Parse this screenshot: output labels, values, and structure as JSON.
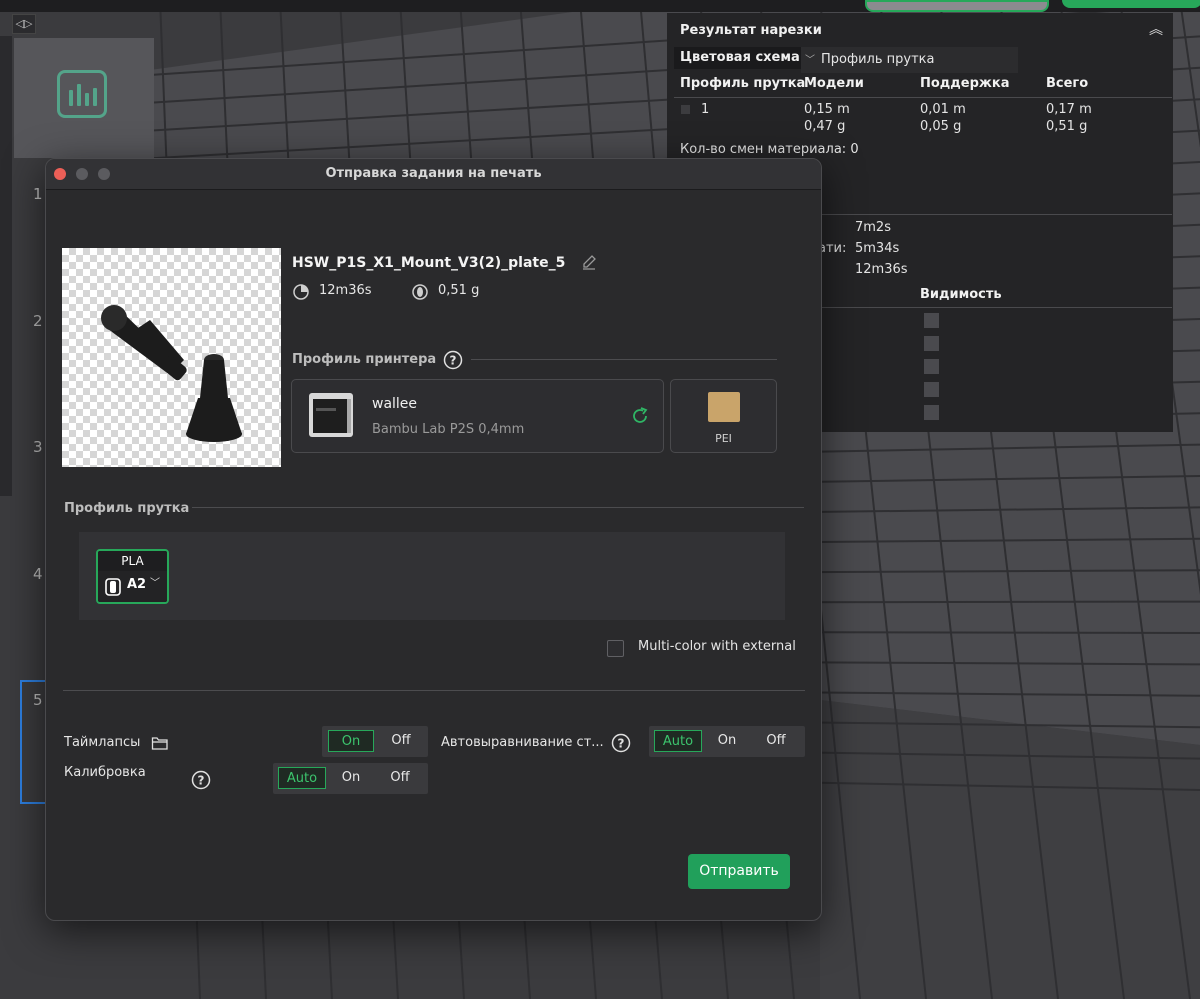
{
  "colors": {
    "accent": "#27a85a",
    "send_button": "#21a05b",
    "dialog_bg": "#2a2a2c",
    "panel_bg": "#242426",
    "selected_plate": "#2d7fe0",
    "build_plate_swatch": "#c9a46a"
  },
  "plates": {
    "numbers": [
      "1",
      "2",
      "3",
      "4",
      "5"
    ]
  },
  "result_panel": {
    "title": "Результат нарезки",
    "color_scheme_label": "Цветовая схема",
    "color_scheme_value": "Профиль прутка",
    "headers": [
      "Профиль прутка",
      "Модели",
      "Поддержка",
      "Всего"
    ],
    "row": {
      "filament": "1",
      "models_length": "0,15 m",
      "models_weight": "0,47 g",
      "support_length": "0,01 m",
      "support_weight": "0,05 g",
      "total_length": "0,17 m",
      "total_weight": "0,51 g"
    },
    "material_changes": "Кол-во смен материала:  0",
    "time_1": "7m2s",
    "time_2_label": "ати:",
    "time_2": "5m34s",
    "time_3_label": ":",
    "time_3": "12m36s",
    "visibility_header": "Видимость"
  },
  "dialog": {
    "title": "Отправка задания на печать",
    "file_name": "HSW_P1S_X1_Mount_V3(2)_plate_5",
    "print_time": "12m36s",
    "weight": "0,51 g",
    "printer_profile_label": "Профиль принтера",
    "printer_name": "wallee",
    "printer_model": "Bambu Lab P2S  0,4mm",
    "plate_type": "PEI",
    "filament_profile_label": "Профиль прутка",
    "filament": {
      "type": "PLA",
      "slot": "A2"
    },
    "multicolor_label": "Multi-color with external",
    "timelapse_label": "Таймлапсы",
    "timelapse_options": [
      "On",
      "Off"
    ],
    "autolevel_label": "Автовыравнивание ст...",
    "autolevel_options": [
      "Auto",
      "On",
      "Off"
    ],
    "calibration_label": "Калибровка",
    "calibration_options": [
      "Auto",
      "On",
      "Off"
    ],
    "send_label": "Отправить"
  }
}
